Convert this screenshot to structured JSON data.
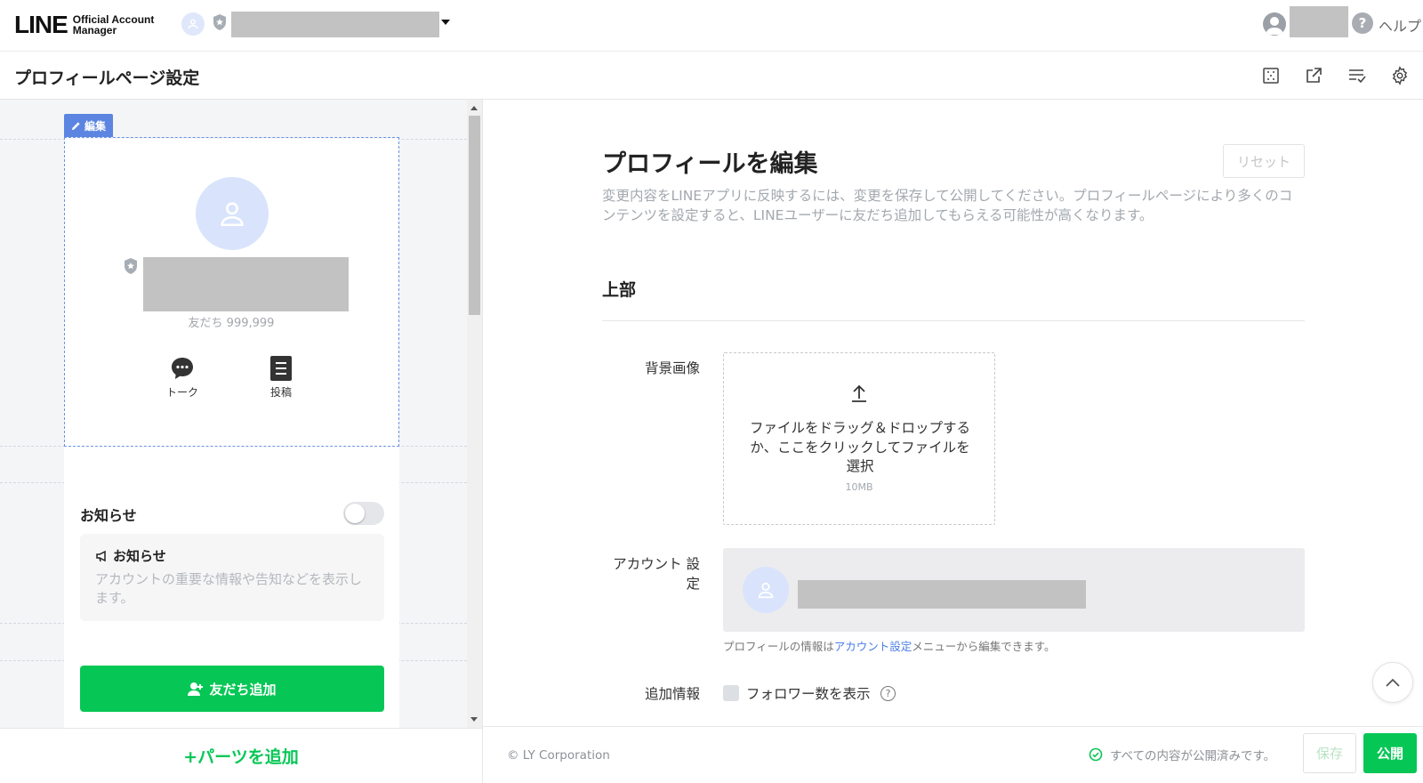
{
  "brand": {
    "logo": "LINE",
    "product_line1": "Official Account",
    "product_line2": "Manager",
    "accent": "#06c755"
  },
  "header": {
    "help_label": "ヘルプ"
  },
  "page": {
    "title": "プロフィールページ設定",
    "toolbar_icons": [
      "layout-grid-icon",
      "external-link-icon",
      "checklist-icon",
      "gear-icon"
    ]
  },
  "preview": {
    "edit_tag": "編集",
    "friends_label": "友だち 999,999",
    "actions": [
      {
        "label": "トーク",
        "icon": "chat-bubble-icon"
      },
      {
        "label": "投稿",
        "icon": "post-list-icon"
      }
    ],
    "notice_toggle_label": "お知らせ",
    "notice_toggle_on": false,
    "notice_card_title": "お知らせ",
    "notice_card_desc": "アカウントの重要な情報や告知などを表示します。",
    "add_friend_button": "友だち追加",
    "add_parts_button": "+パーツを追加"
  },
  "form": {
    "title": "プロフィールを編集",
    "reset_button": "リセット",
    "description": "変更内容をLINEアプリに反映するには、変更を保存して公開してください。プロフィールページにより多くのコンテンツを設定すると、LINEユーザーに友だち追加してもらえる可能性が高くなります。",
    "section_top": "上部",
    "bg_image_label": "背景画像",
    "upload_text": "ファイルをドラッグ＆ドロップするか、ここをクリックしてファイルを選択",
    "upload_size": "10MB",
    "account_settings_label": "アカウント 設定",
    "account_note_pre": "プロフィールの情報は",
    "account_note_link": "アカウント設定",
    "account_note_post": "メニューから編集できます。",
    "extra_info_label": "追加情報",
    "follower_count_label": "フォロワー数を表示",
    "follower_count_checked": false
  },
  "footer": {
    "copyright": "© LY Corporation",
    "status_text": "すべての内容が公開済みです。",
    "save_button": "保存",
    "publish_button": "公開"
  }
}
